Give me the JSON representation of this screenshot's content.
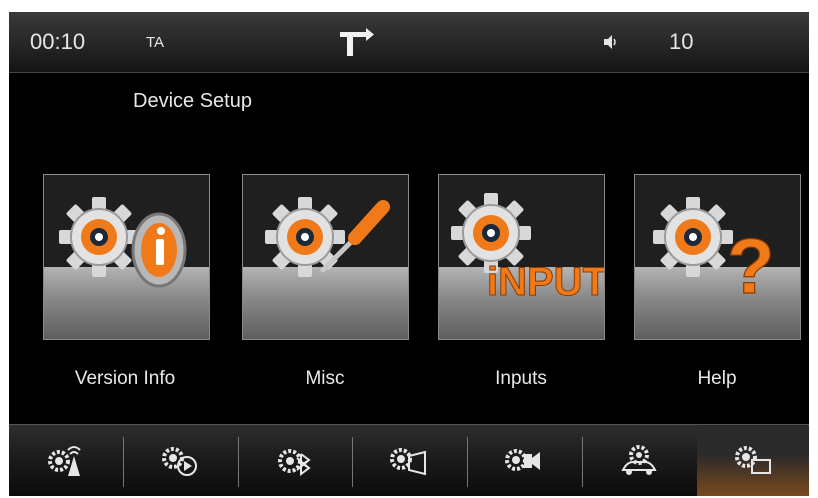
{
  "statusbar": {
    "clock": "00:10",
    "ta": "TA",
    "volume": "10",
    "icons": [
      "navigation-arrow-icon",
      "speaker-icon"
    ]
  },
  "page": {
    "title": "Device Setup"
  },
  "tiles": [
    {
      "label": "Version Info",
      "icon": "gear-info-icon"
    },
    {
      "label": "Misc",
      "icon": "gear-screwdriver-icon"
    },
    {
      "label": "Inputs",
      "icon": "gear-input-icon",
      "badge": "iNPUT"
    },
    {
      "label": "Help",
      "icon": "gear-question-icon",
      "badge": "?"
    }
  ],
  "bottom_nav": {
    "items": [
      "gear-antenna-icon",
      "gear-play-icon",
      "gear-bluetooth-icon",
      "gear-screen-icon",
      "gear-camera-icon",
      "gear-car-icon",
      "gear-display-icon"
    ],
    "active_index": 6
  },
  "colors": {
    "accent": "#f07a1a",
    "background": "#000000",
    "text": "#e8e8e8"
  }
}
